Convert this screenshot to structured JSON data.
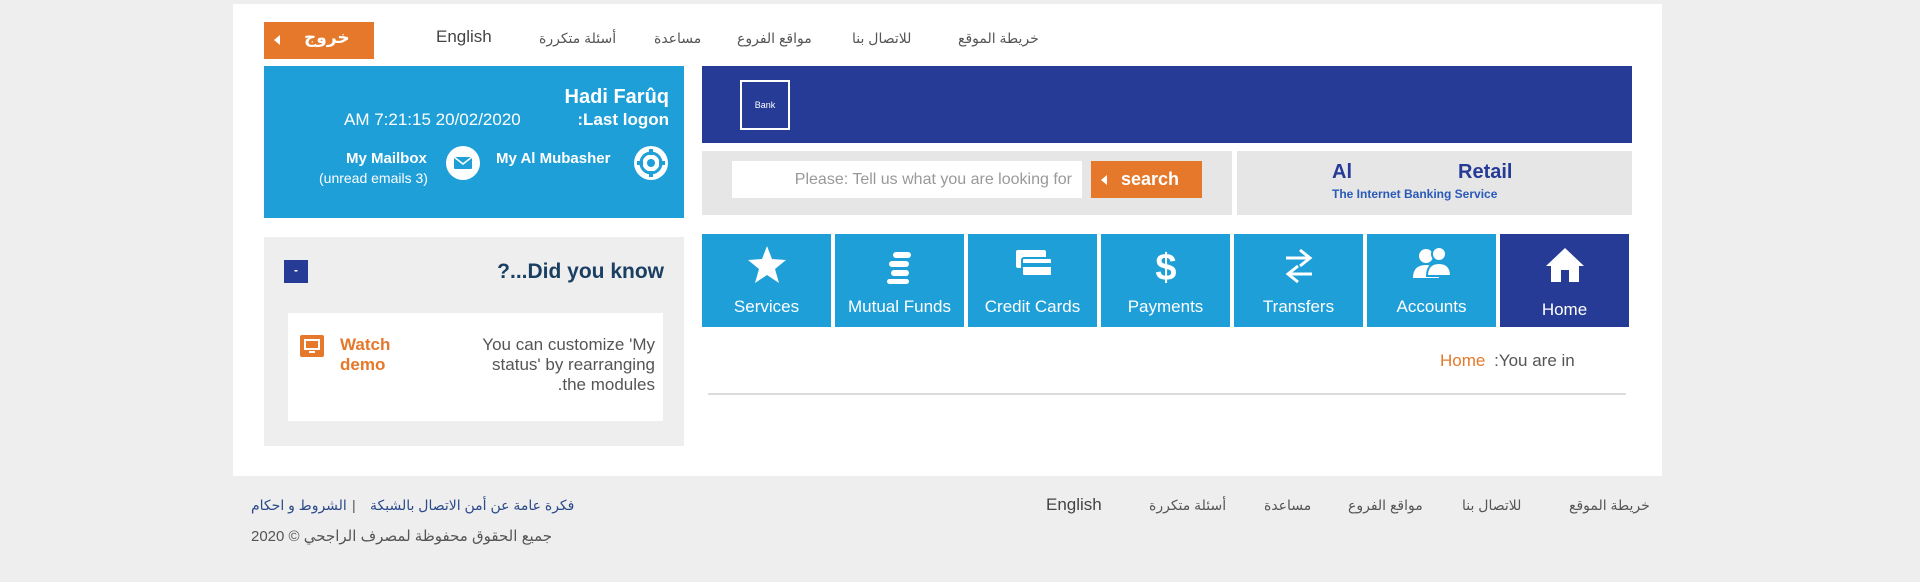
{
  "top_nav": {
    "site_map": "خريطة الموقع",
    "contact_us": "للاتصال بنا",
    "branch_locations": "مواقع الفروع",
    "help": "مساعدة",
    "faq": "أسئلة متكررة",
    "english": "English",
    "logout": "خروج"
  },
  "user": {
    "name": "Hadi Farûq",
    "last_logon_label": ":Last logon",
    "last_logon_value": "AM 7:21:15 20/02/2020",
    "mailbox_label": "My Mailbox",
    "unread_emails": "(unread emails 3)",
    "mubasher_label": "My Al Mubasher"
  },
  "banner": {
    "logo_text": "Bank"
  },
  "search": {
    "placeholder": "Please: Tell us what you are looking for",
    "button_label": "search"
  },
  "retail": {
    "word_al": "Al",
    "word_retail": "Retail",
    "tagline": "The Internet Banking Service"
  },
  "nav_tiles": [
    {
      "label": "Services",
      "icon": "star-icon"
    },
    {
      "label": "Mutual Funds",
      "icon": "coins-icon"
    },
    {
      "label": "Credit Cards",
      "icon": "credit-card-icon"
    },
    {
      "label": "Payments",
      "icon": "dollar-icon"
    },
    {
      "label": "Transfers",
      "icon": "transfer-arrows-icon"
    },
    {
      "label": "Accounts",
      "icon": "users-icon"
    },
    {
      "label": "Home",
      "icon": "home-icon"
    }
  ],
  "breadcrumb": {
    "prefix": ":You are in",
    "current": "Home"
  },
  "did_you_know": {
    "title": "?...Did you know",
    "collapse": "-",
    "watch_demo_line1": "Watch",
    "watch_demo_line2": "demo",
    "tip_line1": "You can customize 'My",
    "tip_line2": "status' by rearranging",
    "tip_line3": ".the modules"
  },
  "footer": {
    "site_map": "خريطة الموقع",
    "contact_us": "للاتصال بنا",
    "branch_locations": "مواقع الفروع",
    "help": "مساعدة",
    "faq": "أسئلة متكررة",
    "english": "English",
    "security_overview": "فكرة عامة عن أمن الاتصال بالشبكة",
    "separator": "|",
    "terms": "الشروط و احكام",
    "copyright": "جميع الحقوق محفوظة لمصرف الراجحي © 2020"
  },
  "colors": {
    "brand_blue": "#1e9fd8",
    "dark_blue": "#253b95",
    "orange": "#e5782a"
  }
}
